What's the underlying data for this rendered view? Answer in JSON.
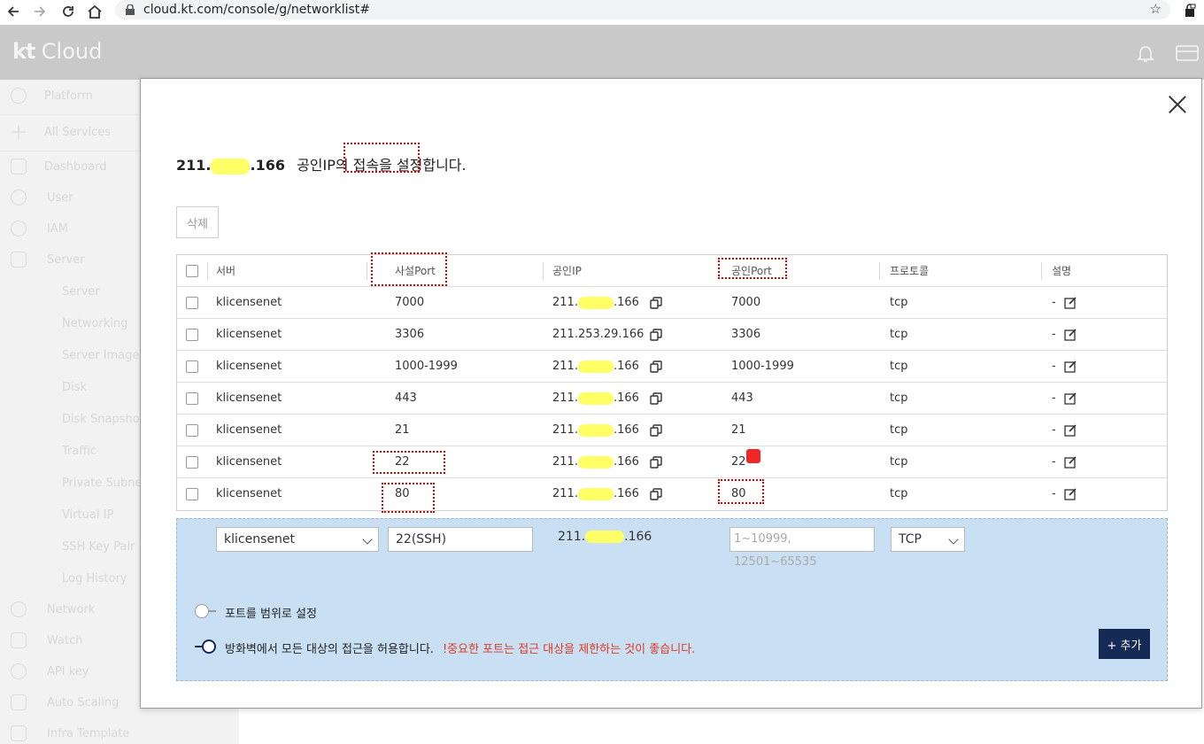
{
  "browser": {
    "url": "cloud.kt.com/console/g/networklist#"
  },
  "header": {
    "logo_kt": "kt",
    "logo_cloud": "Cloud"
  },
  "sidebar": {
    "items": [
      {
        "label": "Platform",
        "icon": "gear-icon"
      },
      {
        "label": "All Services",
        "icon": "plus-icon"
      },
      {
        "label": "Dashboard",
        "icon": "home-icon"
      },
      {
        "label": "User",
        "icon": "user-icon"
      },
      {
        "label": "IAM",
        "icon": "cloud-icon"
      },
      {
        "label": "Server",
        "icon": "chip-icon"
      },
      {
        "label": "Server",
        "icon": ""
      },
      {
        "label": "Networking",
        "icon": ""
      },
      {
        "label": "Server Image",
        "icon": ""
      },
      {
        "label": "Disk",
        "icon": ""
      },
      {
        "label": "Disk Snapshot",
        "icon": ""
      },
      {
        "label": "Traffic",
        "icon": ""
      },
      {
        "label": "Private Subnet",
        "icon": ""
      },
      {
        "label": "Virtual IP",
        "icon": ""
      },
      {
        "label": "SSH Key Pair",
        "icon": ""
      },
      {
        "label": "Log History",
        "icon": ""
      },
      {
        "label": "Network",
        "icon": "network-icon"
      },
      {
        "label": "Watch",
        "icon": "monitor-icon"
      },
      {
        "label": "API key",
        "icon": "key-icon"
      },
      {
        "label": "Auto Scaling",
        "icon": "scale-icon"
      },
      {
        "label": "Infra Template",
        "icon": "template-icon"
      }
    ]
  },
  "modal": {
    "title_ip_start": "211.",
    "title_ip_end": ".166",
    "title_text": "공인IP의 접속을 설정합니다.",
    "delete_label": "삭제",
    "columns": [
      "서버",
      "사설Port",
      "공인IP",
      "공인Port",
      "프로토콜",
      "설명"
    ],
    "rows": [
      {
        "server": "klicensenet",
        "private_port": "7000",
        "ip_start": "211.",
        "ip_end": ".166",
        "public_port": "7000",
        "protocol": "tcp",
        "desc": "-"
      },
      {
        "server": "klicensenet",
        "private_port": "3306",
        "ip_start": "211.253.29.166",
        "ip_end": "",
        "public_port": "3306",
        "protocol": "tcp",
        "desc": "-"
      },
      {
        "server": "klicensenet",
        "private_port": "1000-1999",
        "ip_start": "211.",
        "ip_end": ".166",
        "public_port": "1000-1999",
        "protocol": "tcp",
        "desc": "-"
      },
      {
        "server": "klicensenet",
        "private_port": "443",
        "ip_start": "211.",
        "ip_end": ".166",
        "public_port": "443",
        "protocol": "tcp",
        "desc": "-"
      },
      {
        "server": "klicensenet",
        "private_port": "21",
        "ip_start": "211.",
        "ip_end": ".166",
        "public_port": "21",
        "protocol": "tcp",
        "desc": "-"
      },
      {
        "server": "klicensenet",
        "private_port": "22",
        "ip_start": "211.",
        "ip_end": ".166",
        "public_port": "22",
        "protocol": "tcp",
        "desc": "-"
      },
      {
        "server": "klicensenet",
        "private_port": "80",
        "ip_start": "211.",
        "ip_end": ".166",
        "public_port": "80",
        "protocol": "tcp",
        "desc": "-"
      }
    ],
    "form": {
      "server_value": "klicensenet",
      "private_port_value": "22(SSH)",
      "ip_start": "211.",
      "ip_end": ".166",
      "public_port_placeholder": "1~10999, 12501~65535",
      "protocol_value": "TCP",
      "range_toggle_label": "포트를 범위로 설정",
      "range_toggle_on": false,
      "firewall_toggle_label": "방화벽에서 모든 대상의 접근을 허용합니다.",
      "firewall_toggle_on": true,
      "warning": "!중요한 포트는 접근 대상을 제한하는 것이 좋습니다.",
      "add_label": "+ 추가"
    }
  },
  "colors": {
    "accent_dark": "#152a55",
    "warning": "#e03a1e",
    "panel_bg": "#c9dff3",
    "annotation_red": "#dd0000",
    "redaction_yellow": "#ffff66"
  }
}
